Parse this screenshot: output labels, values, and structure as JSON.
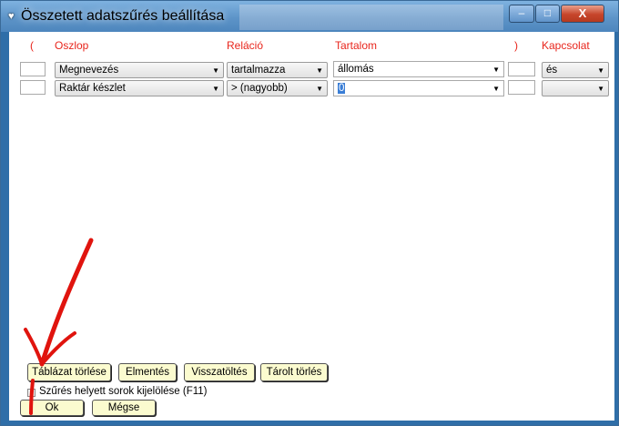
{
  "window": {
    "title": "Összetett adatszűrés beállítása",
    "minimize": "–",
    "maximize": "□",
    "close": "X"
  },
  "headers": {
    "open_paren": "(",
    "column": "Oszlop",
    "relation": "Reláció",
    "content": "Tartalom",
    "close_paren": ")",
    "connection": "Kapcsolat"
  },
  "rows": [
    {
      "open_paren": "",
      "column": "Megnevezés",
      "relation": "tartalmazza",
      "content": "állomás",
      "close_paren": "",
      "connection": "és"
    },
    {
      "open_paren": "",
      "column": "Raktár készlet",
      "relation": "> (nagyobb)",
      "content": "0",
      "close_paren": "",
      "connection": ""
    }
  ],
  "buttons": {
    "clear_table": "Táblázat törlése",
    "save": "Elmentés",
    "reload": "Visszatöltés",
    "delete_stored": "Tárolt törlés",
    "ok": "Ok",
    "cancel": "Mégse"
  },
  "checkbox": {
    "label": "Szűrés helyett sorok kijelölése (F11)",
    "checked": false
  },
  "colors": {
    "header_text": "#e8251c",
    "button_bg": "#fbfbcf",
    "annotation_arrow": "#e0140e"
  }
}
